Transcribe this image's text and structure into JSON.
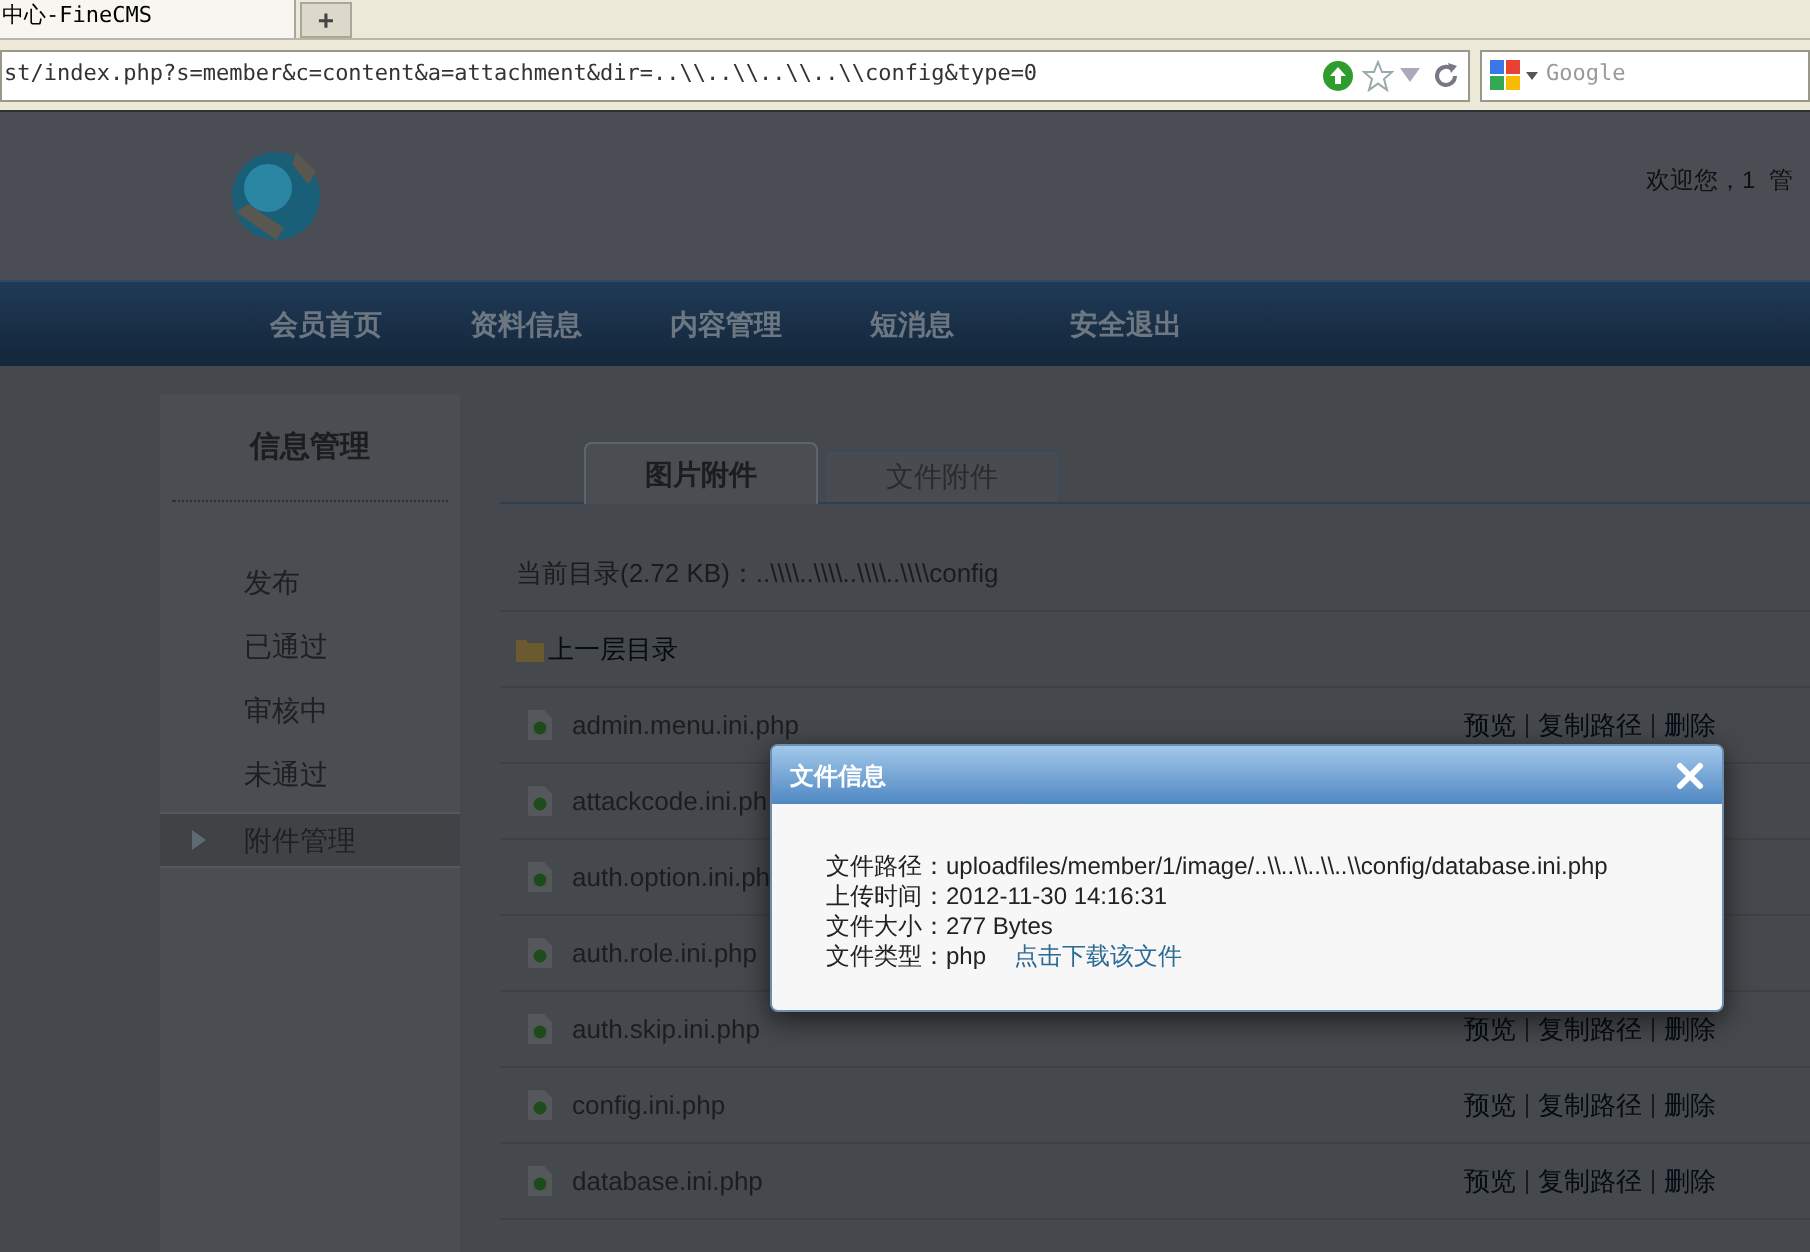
{
  "browser": {
    "tab_title": "中心-FineCMS",
    "new_tab": "+",
    "url": "st/index.php?s=member&c=content&a=attachment&dir=..\\\\..\\\\..\\\\..\\\\config&type=0",
    "search_placeholder": "Google"
  },
  "header": {
    "welcome": "欢迎您，1  管"
  },
  "nav": {
    "items": [
      "会员首页",
      "资料信息",
      "内容管理",
      "短消息",
      "安全退出"
    ]
  },
  "sidebar": {
    "title": "信息管理",
    "items": [
      {
        "label": "发布",
        "selected": false
      },
      {
        "label": "已通过",
        "selected": false
      },
      {
        "label": "审核中",
        "selected": false
      },
      {
        "label": "未通过",
        "selected": false
      },
      {
        "label": "附件管理",
        "selected": true
      }
    ]
  },
  "tabs": [
    {
      "label": "图片附件",
      "selected": true
    },
    {
      "label": "文件附件",
      "selected": false
    }
  ],
  "current_dir": "当前目录(2.72 KB)：..\\\\\\\\..\\\\\\\\..\\\\\\\\..\\\\\\\\config",
  "parent_dir": "上一层目录",
  "files": [
    {
      "name": "admin.menu.ini.php",
      "actions": [
        "预览",
        "复制路径",
        "删除"
      ]
    },
    {
      "name": "attackcode.ini.ph"
    },
    {
      "name": "auth.option.ini.ph"
    },
    {
      "name": "auth.role.ini.php"
    },
    {
      "name": "auth.skip.ini.php",
      "actions": [
        "预览",
        "复制路径",
        "删除"
      ]
    },
    {
      "name": "config.ini.php",
      "actions": [
        "预览",
        "复制路径",
        "删除"
      ]
    },
    {
      "name": "database.ini.php",
      "actions": [
        "预览",
        "复制路径",
        "删除"
      ]
    }
  ],
  "dialog": {
    "title": "文件信息",
    "fields": [
      {
        "label": "文件路径：",
        "value": "uploadfiles/member/1/image/..\\\\..\\\\..\\\\..\\\\config/database.ini.php"
      },
      {
        "label": "上传时间：",
        "value": "2012-11-30 14:16:31"
      },
      {
        "label": "文件大小：",
        "value": "277 Bytes"
      },
      {
        "label": "文件类型：",
        "value": "php",
        "link": "点击下载该文件"
      }
    ]
  }
}
